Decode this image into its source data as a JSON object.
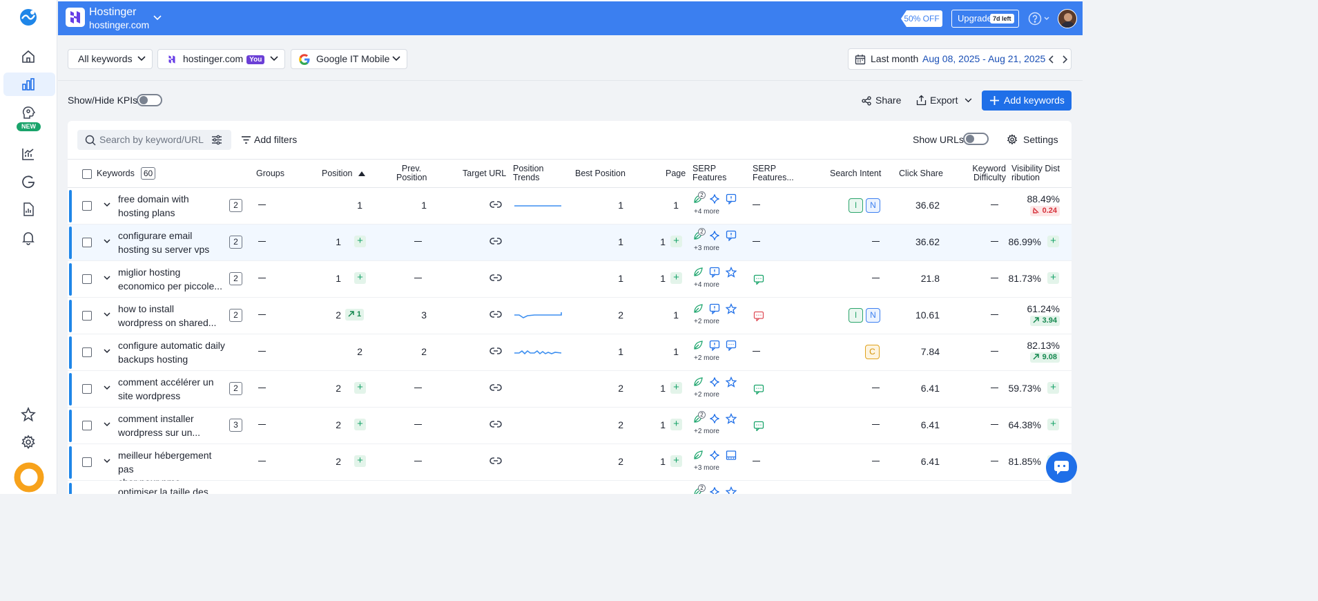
{
  "header": {
    "brand_name": "Hostinger",
    "brand_domain": "hostinger.com",
    "promo": "50% OFF",
    "upgrade_label": "Upgrade",
    "upgrade_badge": "7d left"
  },
  "sidebar": {
    "new_badge": "NEW",
    "items": [
      "home-icon",
      "bar-chart-icon",
      "brain-icon",
      "trend-chart-icon",
      "google-icon",
      "report-icon",
      "bell-icon",
      "star-icon",
      "gear-icon"
    ]
  },
  "filters": {
    "keywords_select": "All keywords",
    "project_select": "hostinger.com",
    "you_badge": "You",
    "engine_select": "Google IT Mobile",
    "period_label": "Last month",
    "date_range": "Aug 08, 2025 - Aug 21, 2025"
  },
  "toolbar": {
    "kpi_label": "Show/Hide KPIs",
    "share_label": "Share",
    "export_label": "Export",
    "add_keywords_label": "Add keywords",
    "search_placeholder": "Search by keyword/URL",
    "add_filters_label": "Add filters",
    "show_urls_label": "Show URLs",
    "settings_label": "Settings"
  },
  "table": {
    "keyword_count": "60",
    "columns": {
      "keywords": "Keywords",
      "groups": "Groups",
      "position": "Position",
      "prev_position": [
        "Prev.",
        "Position"
      ],
      "target_url": "Target URL",
      "position_trends": [
        "Position",
        "Trends"
      ],
      "best_position": "Best Position",
      "page": "Page",
      "serp_features": [
        "SERP",
        "Features"
      ],
      "serp_features_2": [
        "SERP",
        "Features..."
      ],
      "search_intent": "Search Intent",
      "click_share": "Click Share",
      "keyword_difficulty": [
        "Keyword",
        "Difficulty"
      ],
      "visibility": [
        "Visibility Dist",
        "ribution"
      ]
    },
    "rows": [
      {
        "kw1": "free domain with",
        "kw2": "hosting plans",
        "count": "2",
        "position": "1",
        "pos_plus": false,
        "pos_change": "",
        "prev": "1",
        "trend": "flat",
        "best": "1",
        "page": "1",
        "page_plus": false,
        "feat_badge": "2",
        "more": "+4 more",
        "f2": "dash",
        "intent": [
          "I",
          "N"
        ],
        "click_share": "36.62",
        "visibility": "88.49%",
        "vis_change": "0.24",
        "vis_dir": "down",
        "vis_plus": false,
        "highlight": false
      },
      {
        "kw1": "configurare email",
        "kw2": "hosting su server vps",
        "count": "2",
        "position": "1",
        "pos_plus": true,
        "pos_change": "",
        "prev": "",
        "trend": "",
        "best": "1",
        "page": "1",
        "page_plus": true,
        "feat_badge": "2",
        "more": "+3 more",
        "f2": "dash",
        "intent": [],
        "click_share": "36.62",
        "visibility": "86.99%",
        "vis_change": "",
        "vis_dir": "",
        "vis_plus": true,
        "highlight": true
      },
      {
        "kw1": "miglior hosting",
        "kw2": "economico per piccole...",
        "count": "2",
        "position": "1",
        "pos_plus": true,
        "pos_change": "",
        "prev": "",
        "trend": "",
        "best": "1",
        "page": "1",
        "page_plus": true,
        "feat_badge": "",
        "more": "+4 more",
        "f2": "green",
        "intent": [],
        "click_share": "21.8",
        "visibility": "81.73%",
        "vis_change": "",
        "vis_dir": "",
        "vis_plus": true,
        "highlight": false
      },
      {
        "kw1": "how to install",
        "kw2": "wordpress on shared...",
        "count": "2",
        "position": "2",
        "pos_plus": false,
        "pos_change": "1",
        "prev": "3",
        "trend": "dip",
        "best": "2",
        "page": "1",
        "page_plus": false,
        "feat_badge": "",
        "more": "+2 more",
        "f2": "red",
        "intent": [
          "I",
          "N"
        ],
        "click_share": "10.61",
        "visibility": "61.24%",
        "vis_change": "3.94",
        "vis_dir": "up",
        "vis_plus": false,
        "highlight": false
      },
      {
        "kw1": "configure automatic daily",
        "kw2": "backups hosting",
        "count": "",
        "position": "2",
        "pos_plus": false,
        "pos_change": "",
        "prev": "2",
        "trend": "wave",
        "best": "1",
        "page": "1",
        "page_plus": false,
        "feat_badge": "",
        "more": "+2 more",
        "f2": "dash",
        "intent": [
          "C"
        ],
        "click_share": "7.84",
        "visibility": "82.13%",
        "vis_change": "9.08",
        "vis_dir": "up",
        "vis_plus": false,
        "highlight": false
      },
      {
        "kw1": "comment accélérer un",
        "kw2": "site wordpress",
        "count": "2",
        "position": "2",
        "pos_plus": true,
        "pos_change": "",
        "prev": "",
        "trend": "",
        "best": "2",
        "page": "1",
        "page_plus": true,
        "feat_badge": "",
        "more": "+2 more",
        "f2": "green",
        "intent": [],
        "click_share": "6.41",
        "visibility": "59.73%",
        "vis_change": "",
        "vis_dir": "",
        "vis_plus": true,
        "highlight": false
      },
      {
        "kw1": "comment installer",
        "kw2": "wordpress sur un...",
        "count": "3",
        "position": "2",
        "pos_plus": true,
        "pos_change": "",
        "prev": "",
        "trend": "",
        "best": "2",
        "page": "1",
        "page_plus": true,
        "feat_badge": "2",
        "more": "+2 more",
        "f2": "green",
        "intent": [],
        "click_share": "6.41",
        "visibility": "64.38%",
        "vis_change": "",
        "vis_dir": "",
        "vis_plus": true,
        "highlight": false
      },
      {
        "kw1": "meilleur hébergement pas",
        "kw2": "cher pour pme",
        "count": "",
        "position": "2",
        "pos_plus": true,
        "pos_change": "",
        "prev": "",
        "trend": "",
        "best": "2",
        "page": "1",
        "page_plus": true,
        "feat_badge": "",
        "more": "+3 more",
        "f2": "dash",
        "intent": [],
        "click_share": "6.41",
        "visibility": "81.85%",
        "vis_change": "",
        "vis_dir": "",
        "vis_plus": true,
        "highlight": false
      },
      {
        "kw1": "optimiser la taille des",
        "kw2": "",
        "count": "",
        "position": "",
        "pos_plus": false,
        "pos_change": "",
        "prev": "",
        "trend": "",
        "best": "",
        "page": "",
        "page_plus": false,
        "feat_badge": "2",
        "more": "",
        "f2": "none",
        "intent": [],
        "click_share": "",
        "visibility": "",
        "vis_change": "",
        "vis_dir": "",
        "vis_plus": false,
        "highlight": false
      }
    ]
  },
  "colors": {
    "brand_blue": "#3b7ff0",
    "accent": "#1f6fe8",
    "row_bar": "#1f86e8",
    "positive": "#1aa46b",
    "negative": "#d6303a"
  }
}
